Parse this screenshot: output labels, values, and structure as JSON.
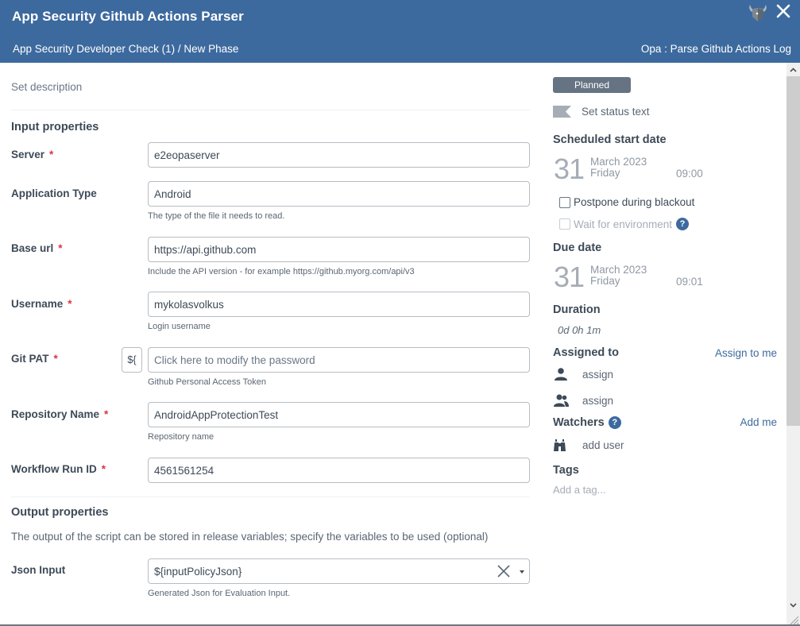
{
  "header": {
    "title": "App Security Github Actions Parser",
    "breadcrumb": "App Security Developer Check (1) / New Phase",
    "task_type": "Opa : Parse Github Actions Log",
    "logo_icon": "opa-viking-helmet-icon",
    "close_icon": "close-icon",
    "color": "#3d6a9e"
  },
  "main": {
    "set_description": "Set description",
    "input_section_title": "Input properties",
    "fields": [
      {
        "label": "Server",
        "required": true,
        "value": "e2eopaserver",
        "help": ""
      },
      {
        "label": "Application Type",
        "required": false,
        "value": "Android",
        "help": "The type of the file it needs to read."
      },
      {
        "label": "Base url",
        "required": true,
        "value": "https://api.github.com",
        "help": "Include the API version - for example https://github.myorg.com/api/v3"
      },
      {
        "label": "Username",
        "required": true,
        "value": "mykolasvolkus",
        "help": "Login username"
      },
      {
        "label": "Git PAT",
        "required": true,
        "value": "",
        "placeholder": "Click here to modify the password",
        "help": "Github Personal Access Token",
        "variable_button": "${"
      },
      {
        "label": "Repository Name",
        "required": true,
        "value": "AndroidAppProtectionTest",
        "help": "Repository name"
      },
      {
        "label": "Workflow Run ID",
        "required": true,
        "value": "4561561254",
        "help": ""
      }
    ],
    "required_marker": "*",
    "output_section_title": "Output properties",
    "output_description": "The output of the script can be stored in release variables; specify the variables to be used (optional)",
    "output_fields": [
      {
        "label": "Json Input",
        "value": "${inputPolicyJson}",
        "help": "Generated Json for Evaluation Input."
      }
    ]
  },
  "side": {
    "status": "Planned",
    "status_color": "#667382",
    "status_text": "Set status text",
    "scheduled_start": {
      "heading": "Scheduled start date",
      "day": "31",
      "month_year": "March 2023",
      "weekday": "Friday",
      "time": "09:00"
    },
    "postpone_label": "Postpone during blackout",
    "postpone_checked": false,
    "wait_env_label": "Wait for environment",
    "wait_env_checked": false,
    "help_glyph": "?",
    "due_date": {
      "heading": "Due date",
      "day": "31",
      "month_year": "March 2023",
      "weekday": "Friday",
      "time": "09:01"
    },
    "duration_heading": "Duration",
    "duration": "0d 0h 1m",
    "assigned_heading": "Assigned to",
    "assign_to_me": "Assign to me",
    "assign_user": "assign",
    "assign_team": "assign",
    "watchers_heading": "Watchers",
    "add_me": "Add me",
    "add_user": "add user",
    "tags_heading": "Tags",
    "tags_placeholder": "Add a tag..."
  }
}
